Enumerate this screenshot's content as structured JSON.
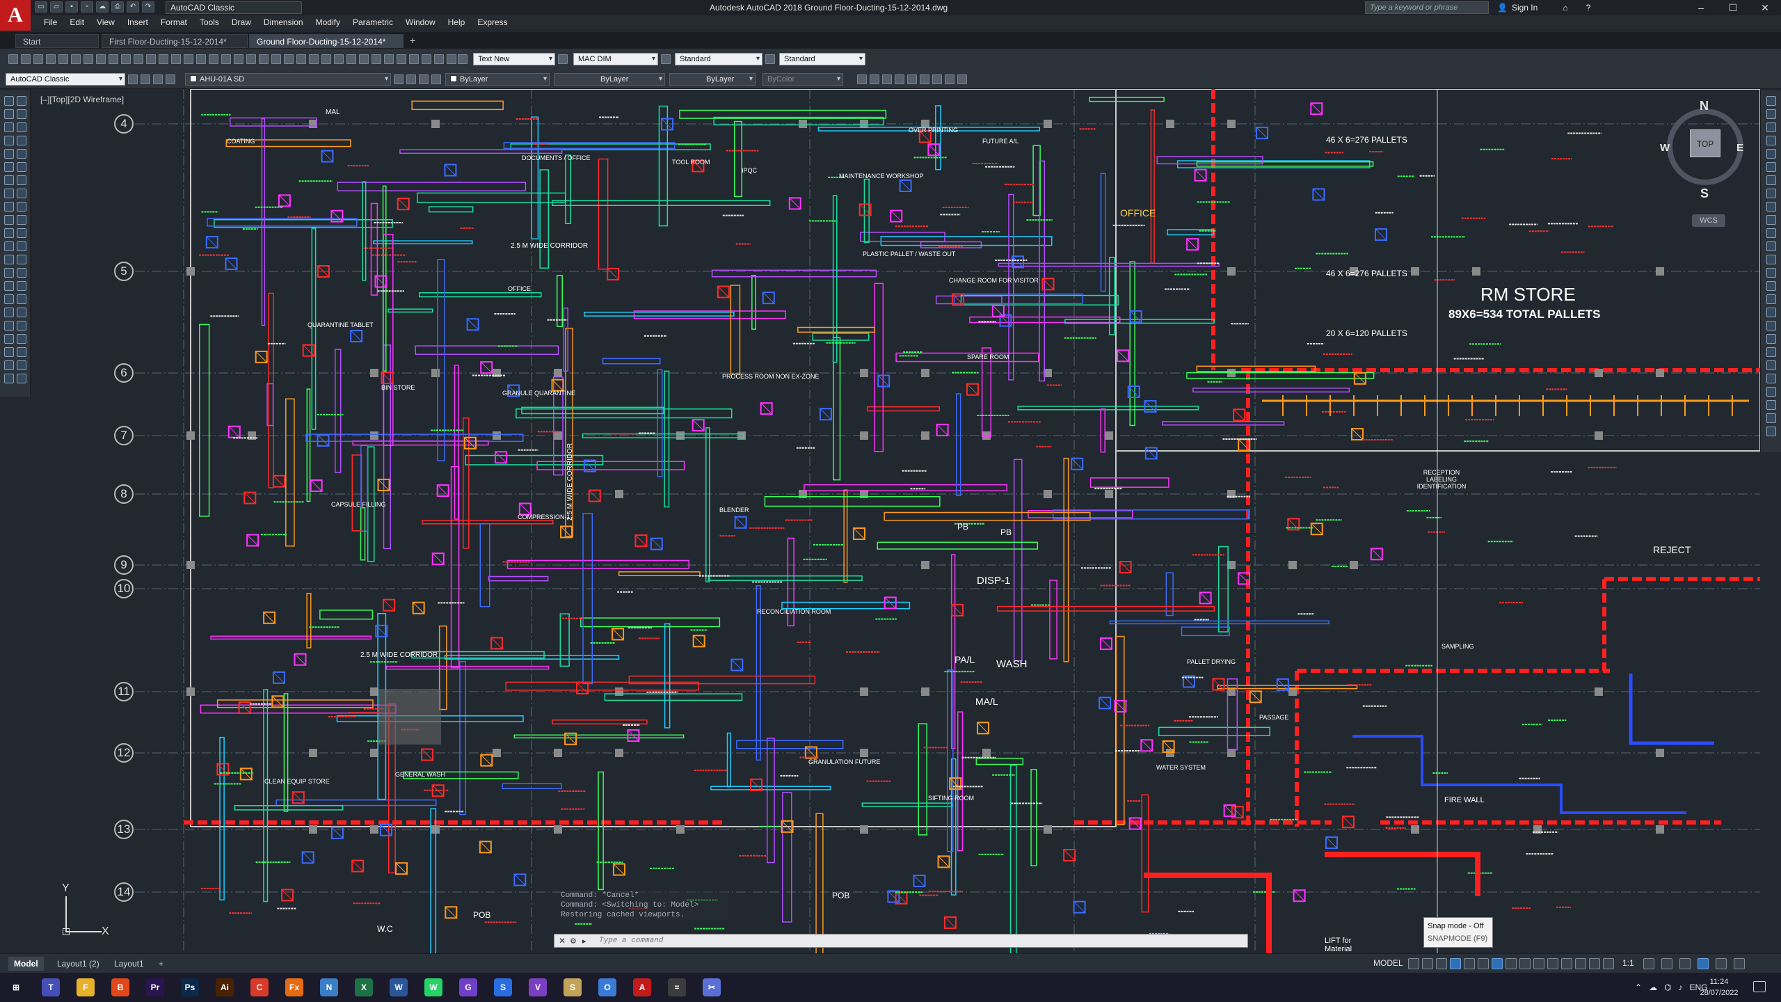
{
  "window": {
    "app_logo": "A",
    "title": "Autodesk AutoCAD 2018   Ground Floor-Ducting-15-12-2014.dwg",
    "workspace": "AutoCAD Classic",
    "search_placeholder": "Type a keyword or phrase",
    "sign_in": "Sign In",
    "minimize": "–",
    "maximize": "☐",
    "close": "✕"
  },
  "menu": [
    "File",
    "Edit",
    "View",
    "Insert",
    "Format",
    "Tools",
    "Draw",
    "Dimension",
    "Modify",
    "Parametric",
    "Window",
    "Help",
    "Express"
  ],
  "tabs": [
    {
      "label": "Start"
    },
    {
      "label": "First Floor-Ducting-15-12-2014*"
    },
    {
      "label": "Ground Floor-Ducting-15-12-2014*"
    }
  ],
  "toolbar": {
    "text_style": "Text New",
    "dim_style": "MAC DIM",
    "table_style": "Standard",
    "mleader_style": "Standard",
    "workspace2": "AutoCAD Classic",
    "layer": "AHU-01A SD",
    "color": "ByLayer",
    "linetype": "ByLayer",
    "lineweight": "ByLayer",
    "plotstyle": "ByColor"
  },
  "viewport": {
    "label": "[–][Top][2D Wireframe]",
    "compass": {
      "n": "N",
      "s": "S",
      "e": "E",
      "w": "W"
    },
    "cube_face": "TOP",
    "wcs": "WCS",
    "ucs_y": "Y",
    "ucs_x": "X"
  },
  "grid_bubbles": [
    "4",
    "5",
    "6",
    "7",
    "8",
    "9",
    "10",
    "11",
    "12",
    "13",
    "14"
  ],
  "drawing_labels": {
    "rm_store": "RM STORE",
    "rm_store_sub": "89X6=534 TOTAL PALLETS",
    "pallets_1": "46 X 6=276 PALLETS",
    "pallets_2": "46 X 6=276 PALLETS",
    "pallets_3": "20 X 6=120 PALLETS",
    "office": "OFFICE",
    "reject": "REJECT",
    "disp": "DISP-1",
    "wash": "WASH",
    "pal": "PA/L",
    "mal": "MA/L",
    "pb": "PB",
    "pb2": "PB",
    "corridor1": "2.5 M WIDE CORRIDOR",
    "corridor2": "2.5 M WIDE CORRIDOR",
    "corridor_v": "2.5 M WIDE CORRIDOR",
    "coating": "COATING",
    "tool_room": "TOOL ROOM",
    "docs_office": "DOCUMENTS / OFFICE",
    "ipqc": "IPQC",
    "maintenance": "MAINTENANCE WORKSHOP",
    "over_printing": "OVER PRINTING",
    "future_al": "FUTURE A/L",
    "bin_store": "BIN STORE",
    "process_room": "PROCESS ROOM NON EX-ZONE",
    "capsule_filling": "CAPSULE FILLING",
    "blender": "BLENDER",
    "compression": "COMPRESSION-1",
    "reconciliation": "RECONCILIATION ROOM",
    "granulation": "GRANULATION FUTURE",
    "sifting": "SIFTING ROOM",
    "general_wash": "GENERAL WASH",
    "clean_equip": "CLEAN EQUIP STORE",
    "water_system": "WATER SYSTEM",
    "pallet_drying": "PALLET DRYING",
    "passage": "PASSAGE",
    "sampling": "SAMPLING",
    "fire_wall": "FIRE WALL",
    "pob": "POB",
    "pob2": "POB",
    "wc": "W.C",
    "lift": "LIFT for Material",
    "spare_room": "SPARE ROOM",
    "quarantine": "QUARANTINE TABLET",
    "granule_q": "GRANULE QUARANTINE",
    "change_room": "CHANGE ROOM FOR VISITOR",
    "reception": "RECEPTION LABELING IDENTIFICATION",
    "plastic_pallet": "PLASTIC PALLET / WASTE OUT",
    "mal_top": "MAL",
    "office2": "OFFICE"
  },
  "command": {
    "history": [
      "Command: *Cancel*",
      "Command:  <Switching to: Model>",
      "Restoring cached viewports."
    ],
    "placeholder": "Type a command"
  },
  "snap_tooltip": {
    "line1": "Snap mode - Off",
    "line2": "SNAPMODE (F9)"
  },
  "layout_tabs": [
    "Model",
    "Layout1 (2)",
    "Layout1"
  ],
  "status": {
    "model": "MODEL",
    "scale": "1:1"
  },
  "taskbar": {
    "apps": [
      {
        "name": "windows-start",
        "label": "⊞",
        "color": "#1b1a2b"
      },
      {
        "name": "teams",
        "label": "T",
        "color": "#464eb8"
      },
      {
        "name": "file-explorer",
        "label": "F",
        "color": "#e8b12c"
      },
      {
        "name": "brave",
        "label": "B",
        "color": "#e0481b"
      },
      {
        "name": "premiere",
        "label": "Pr",
        "color": "#2a1550"
      },
      {
        "name": "photoshop",
        "label": "Ps",
        "color": "#0b2a4a"
      },
      {
        "name": "illustrator",
        "label": "Ai",
        "color": "#4a2200"
      },
      {
        "name": "chrome",
        "label": "C",
        "color": "#d93b2b"
      },
      {
        "name": "firefox",
        "label": "Fx",
        "color": "#e46b12"
      },
      {
        "name": "notepad",
        "label": "N",
        "color": "#3b7ec6"
      },
      {
        "name": "excel",
        "label": "X",
        "color": "#1e7145"
      },
      {
        "name": "word",
        "label": "W",
        "color": "#2b579a"
      },
      {
        "name": "whatsapp",
        "label": "W",
        "color": "#25d366"
      },
      {
        "name": "github",
        "label": "G",
        "color": "#6e40c9"
      },
      {
        "name": "sourcetree",
        "label": "S",
        "color": "#2a6de0"
      },
      {
        "name": "vscode",
        "label": "V",
        "color": "#7b3fc2"
      },
      {
        "name": "store",
        "label": "S",
        "color": "#c2a35a"
      },
      {
        "name": "onedrive",
        "label": "O",
        "color": "#3a7bd5"
      },
      {
        "name": "autocad",
        "label": "A",
        "color": "#c21b1b"
      },
      {
        "name": "calculator",
        "label": "=",
        "color": "#3c3c3c"
      },
      {
        "name": "snipping",
        "label": "✂",
        "color": "#5a6fd6"
      }
    ],
    "lang": "ENG",
    "time": "11:24",
    "date": "28/07/2022"
  }
}
